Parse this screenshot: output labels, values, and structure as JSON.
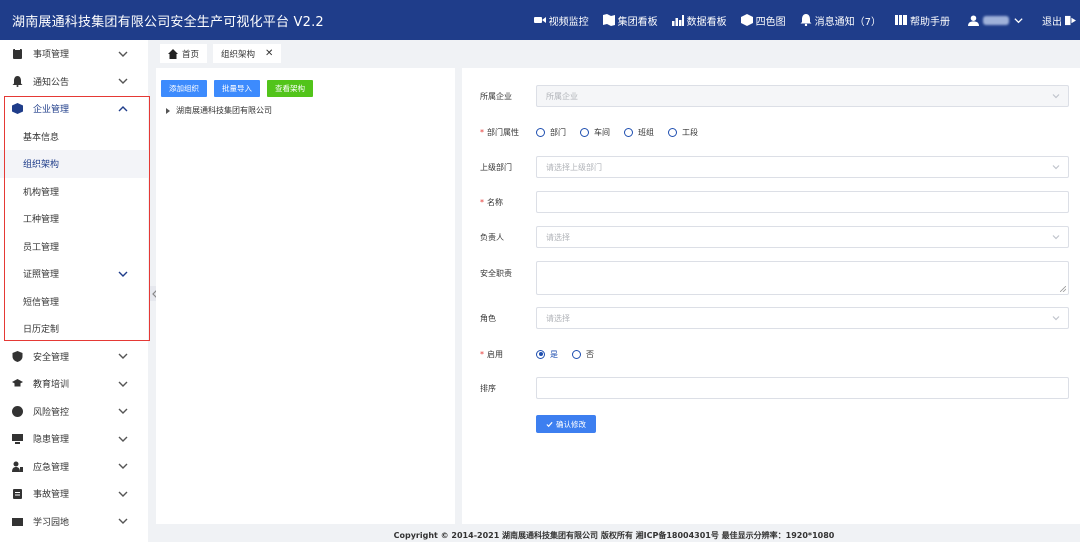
{
  "header": {
    "title": "湖南展通科技集团有限公司安全生产可视化平台  V2.2",
    "nav": [
      {
        "label": "视频监控",
        "icon": "video-icon"
      },
      {
        "label": "集团看板",
        "icon": "map-icon"
      },
      {
        "label": "数据看板",
        "icon": "chart-icon"
      },
      {
        "label": "四色图",
        "icon": "cube-icon"
      },
      {
        "label": "消息通知（7）",
        "icon": "bell-icon"
      },
      {
        "label": "帮助手册",
        "icon": "book-icon"
      }
    ],
    "logout_label": "退出"
  },
  "sidebar": {
    "items": [
      {
        "label": "事项管理",
        "icon": "clipboard-icon"
      },
      {
        "label": "通知公告",
        "icon": "bell-icon"
      },
      {
        "label": "企业管理",
        "icon": "building-icon",
        "open": true
      },
      {
        "label": "安全管理",
        "icon": "shield-icon"
      },
      {
        "label": "教育培训",
        "icon": "graduation-cap-icon"
      },
      {
        "label": "风险管控",
        "icon": "risk-icon"
      },
      {
        "label": "隐患管理",
        "icon": "hazard-icon"
      },
      {
        "label": "应急管理",
        "icon": "emergency-icon"
      },
      {
        "label": "事故管理",
        "icon": "accident-icon"
      },
      {
        "label": "学习园地",
        "icon": "study-icon"
      }
    ],
    "sub_items": [
      "基本信息",
      "组织架构",
      "机构管理",
      "工种管理",
      "员工管理",
      "证照管理",
      "短信管理",
      "日历定制"
    ]
  },
  "tabs": [
    {
      "label": "首页",
      "icon": "home-icon"
    },
    {
      "label": "组织架构",
      "closable": true
    }
  ],
  "tree": {
    "buttons": [
      "添加组织",
      "批量导入",
      "查看架构"
    ],
    "root": "湖南展通科技集团有限公司"
  },
  "form": {
    "enterprise": {
      "label": "所属企业",
      "placeholder": "所属企业"
    },
    "dept_attr": {
      "label": "部门属性",
      "options": [
        "部门",
        "车间",
        "班组",
        "工段"
      ]
    },
    "parent_dept": {
      "label": "上级部门",
      "placeholder": "请选择上级部门"
    },
    "name": {
      "label": "名称"
    },
    "leader": {
      "label": "负责人",
      "placeholder": "请选择"
    },
    "safety_duty": {
      "label": "安全职责"
    },
    "role": {
      "label": "角色",
      "placeholder": "请选择"
    },
    "enabled": {
      "label": "启用",
      "options": [
        "是",
        "否"
      ],
      "selected": "是"
    },
    "sort": {
      "label": "排序"
    },
    "confirm_label": "确认修改"
  },
  "footer": "Copyright © 2014-2021 湖南展通科技集团有限公司 版权所有 湘ICP备18004301号 最佳显示分辨率：1920*1080",
  "colors": {
    "header": "#1f3d8a",
    "primary": "#3d8bfd",
    "success": "#52c41a",
    "highlight": "#e53935"
  }
}
